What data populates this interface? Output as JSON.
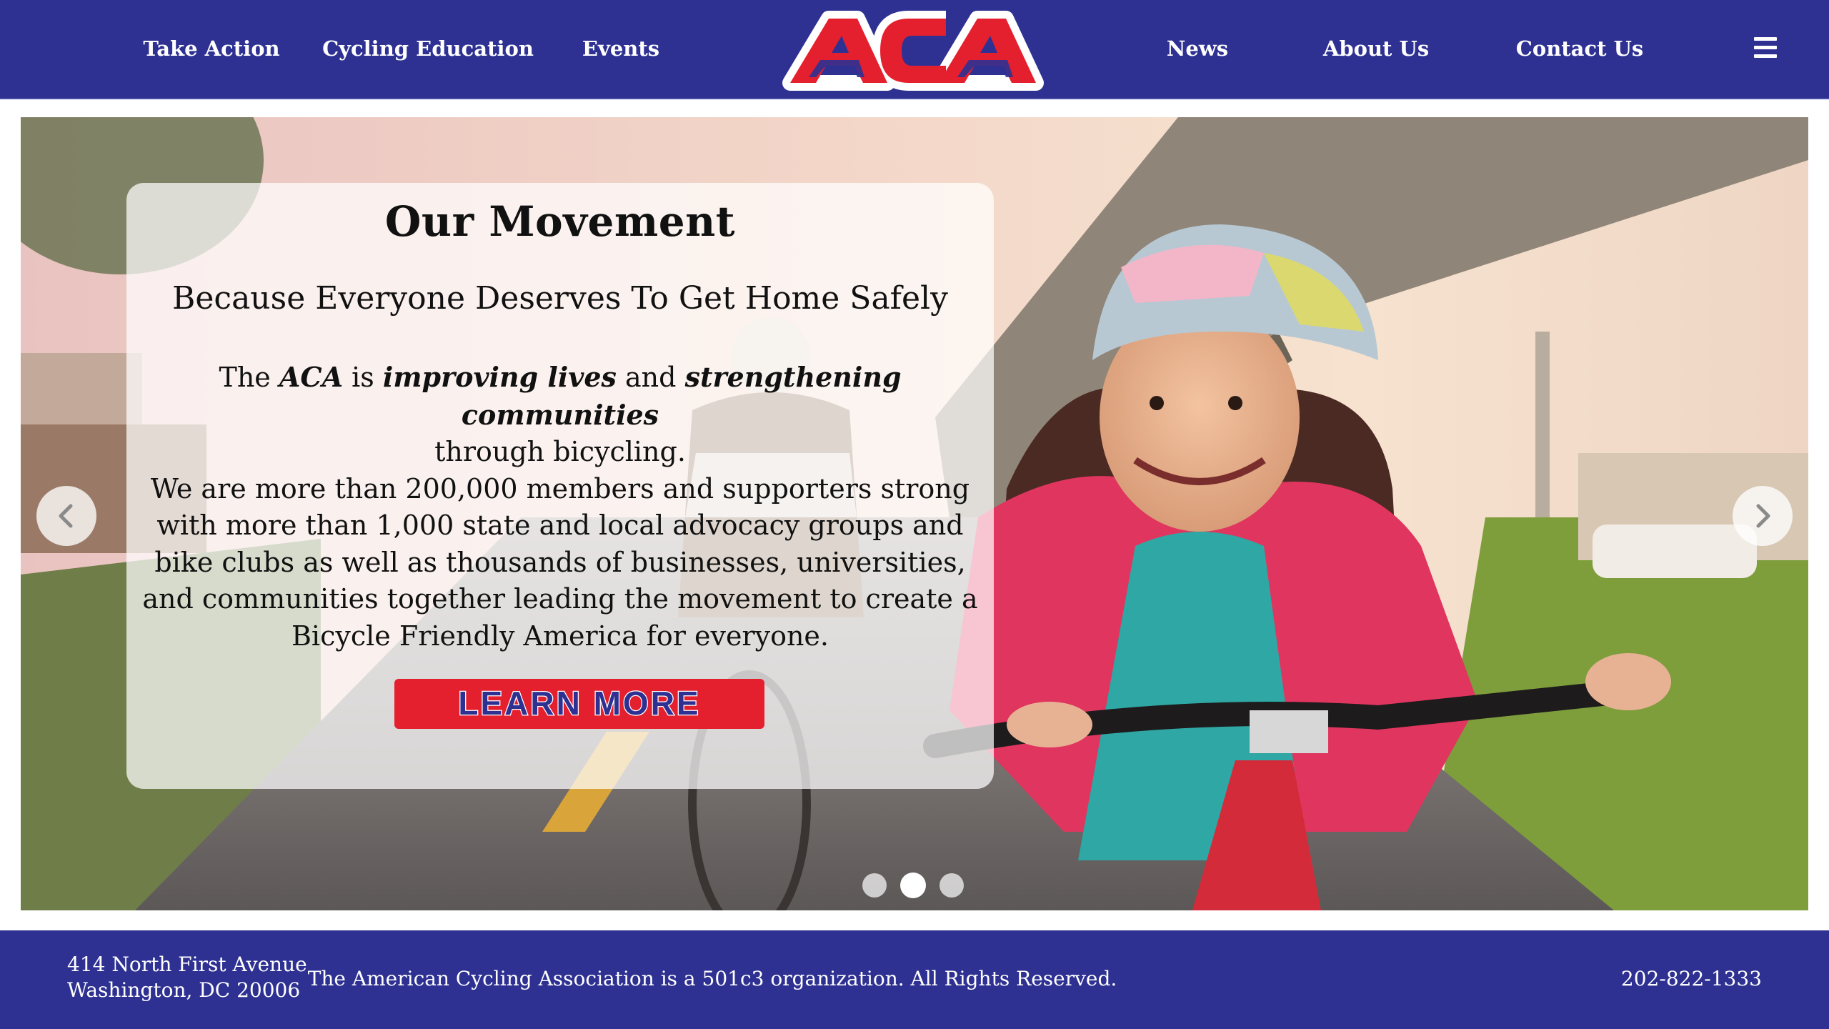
{
  "brand": {
    "logo_text": "ACA",
    "colors": {
      "nav_bg": "#2e3192",
      "logo_red": "#e5202e",
      "white": "#ffffff"
    }
  },
  "nav": {
    "left": [
      {
        "label": "Take Action"
      },
      {
        "label": "Cycling Education"
      },
      {
        "label": "Events"
      }
    ],
    "right": [
      {
        "label": "News"
      },
      {
        "label": "About Us"
      },
      {
        "label": "Contact Us"
      }
    ],
    "menu_icon": "hamburger-menu-icon"
  },
  "hero": {
    "title": "Our Movement",
    "subtitle": "Because Everyone Deserves To Get Home Safely",
    "body": {
      "p1_a": "The ",
      "p1_b": "ACA",
      "p1_c": " is ",
      "p1_d": "improving lives",
      "p1_e": " and ",
      "p1_f": "strengthening communities",
      "p1_g": "through bicycling.",
      "p2": "We are more than 200,000 members and supporters strong with more than 1,000 state and local advocacy groups and bike clubs as well as thousands of businesses, universities, and communities together leading the movement to create a Bicycle Friendly America for everyone."
    },
    "cta_label": "LEARN MORE",
    "prev_icon": "chevron-left-icon",
    "next_icon": "chevron-right-icon",
    "slides": {
      "count": 3,
      "active_index": 1
    }
  },
  "footer": {
    "address_line1": "414 North First Avenue",
    "address_line2": "Washington, DC 20006",
    "legal": "The American Cycling Association is a 501c3 organization. All Rights Reserved.",
    "phone": "202-822-1333"
  }
}
